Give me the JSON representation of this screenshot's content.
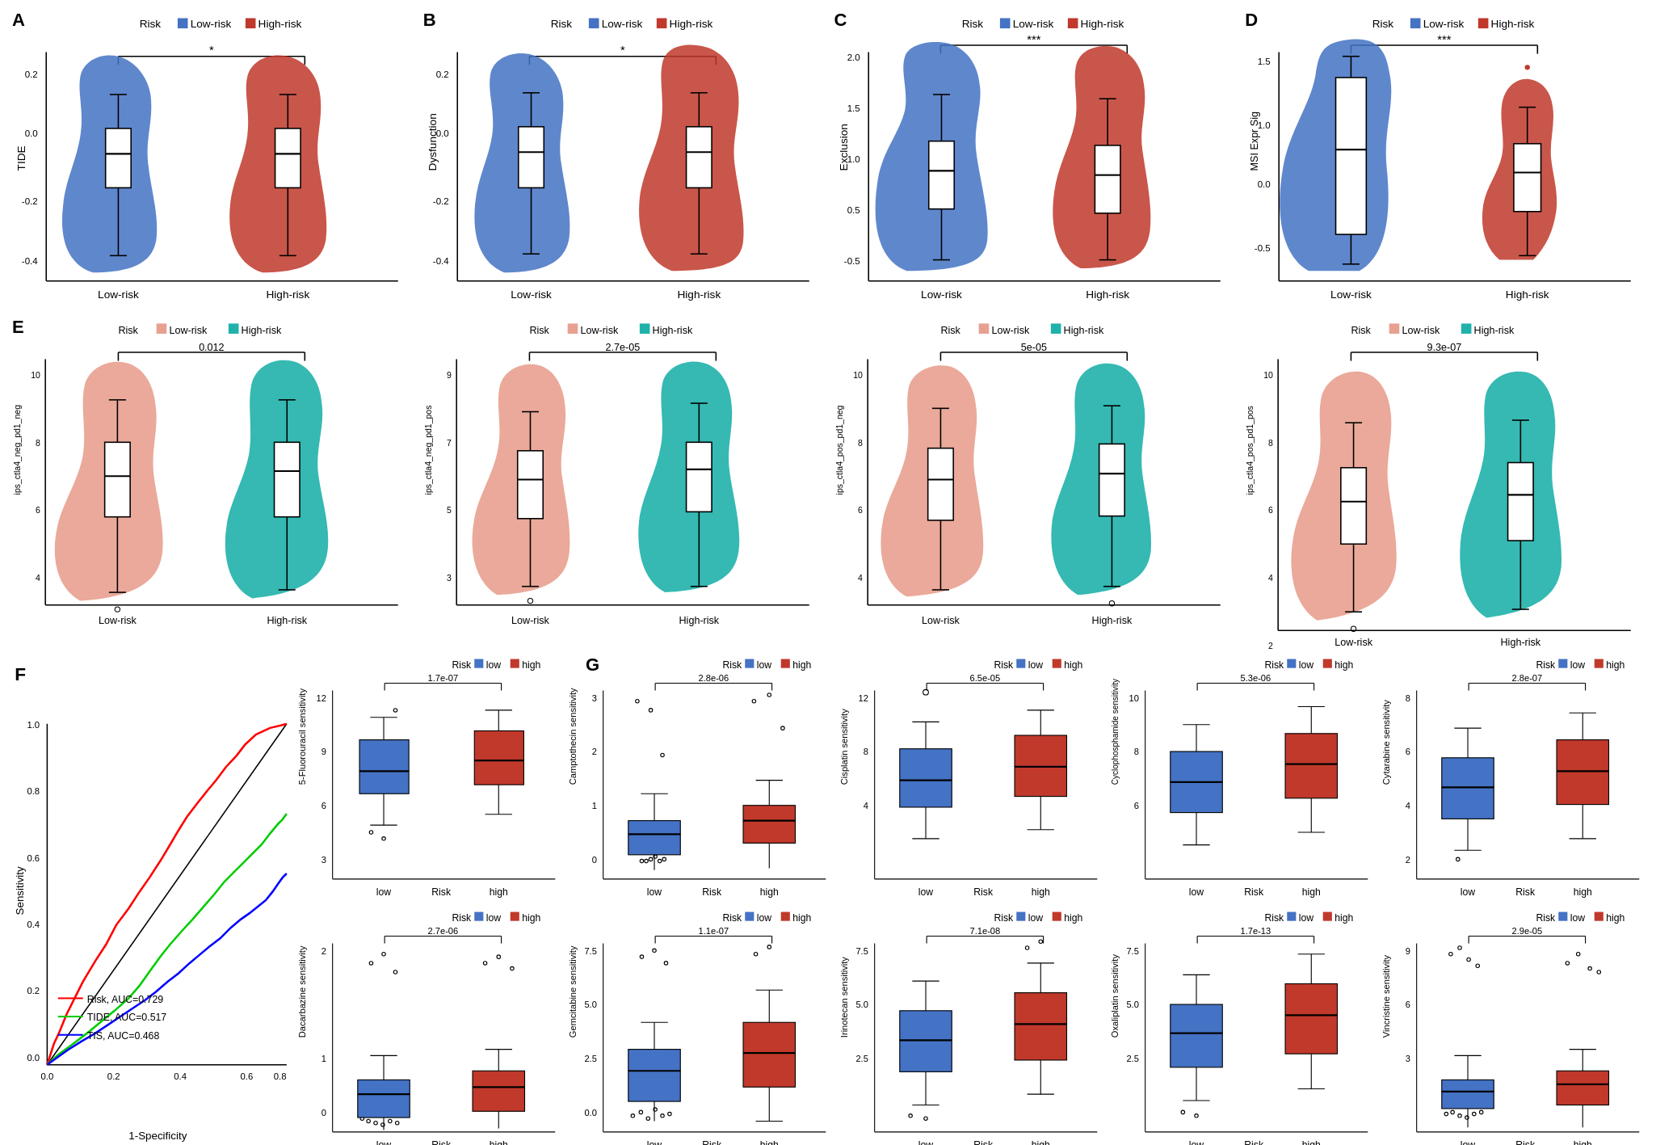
{
  "figure": {
    "panels": {
      "A": {
        "label": "A",
        "legend": {
          "title": "Risk",
          "low": "Low-risk",
          "high": "High-risk",
          "low_color": "#4472C4",
          "high_color": "#C0392B"
        },
        "ylabel": "TIDE",
        "xlabel_low": "Low-risk",
        "xlabel_high": "High-risk",
        "pvalue": "*"
      },
      "B": {
        "label": "B",
        "legend": {
          "title": "Risk",
          "low": "Low-risk",
          "high": "High-risk",
          "low_color": "#4472C4",
          "high_color": "#C0392B"
        },
        "ylabel": "Dysfunction",
        "xlabel_low": "Low-risk",
        "xlabel_high": "High-risk",
        "pvalue": "*"
      },
      "C": {
        "label": "C",
        "legend": {
          "title": "Risk",
          "low": "Low-risk",
          "high": "High-risk",
          "low_color": "#4472C4",
          "high_color": "#C0392B"
        },
        "ylabel": "Exclusion",
        "xlabel_low": "Low-risk",
        "xlabel_high": "High-risk",
        "pvalue": "***"
      },
      "D": {
        "label": "D",
        "legend": {
          "title": "Risk",
          "low": "Low-risk",
          "high": "High-risk",
          "low_color": "#4472C4",
          "high_color": "#C0392B"
        },
        "ylabel": "MSI Expr Sig",
        "xlabel_low": "Low-risk",
        "xlabel_high": "High-risk",
        "pvalue": "***"
      },
      "E": {
        "label": "E",
        "subplots": [
          {
            "ylabel": "ips_ctla4_neg_pd1_neg",
            "pvalue": "0.012",
            "low_color": "#E8A090",
            "high_color": "#20B2AA"
          },
          {
            "ylabel": "ips_ctla4_neg_pd1_pos",
            "pvalue": "2.7e-05",
            "low_color": "#E8A090",
            "high_color": "#20B2AA"
          },
          {
            "ylabel": "ips_ctla4_pos_pd1_neg",
            "pvalue": "5e-05",
            "low_color": "#E8A090",
            "high_color": "#20B2AA"
          },
          {
            "ylabel": "ips_ctla4_pos_pd1_pos",
            "pvalue": "9.3e-07",
            "low_color": "#E8A090",
            "high_color": "#20B2AA"
          }
        ]
      },
      "F": {
        "label": "F",
        "xlabel": "1-Specificity",
        "ylabel": "Sensitivity",
        "curves": [
          {
            "name": "Risk, AUC=0.729",
            "color": "#FF0000"
          },
          {
            "name": "TIDE, AUC=0.517",
            "color": "#00CC00"
          },
          {
            "name": "TIS, AUC=0.468",
            "color": "#0000FF"
          }
        ],
        "diagonal": "#000000"
      },
      "G": {
        "label": "G",
        "row1": [
          {
            "drug": "5-Fluorouracil sensitivity",
            "pvalue": "1.7e-07",
            "low_color": "#4472C4",
            "high_color": "#C0392B"
          },
          {
            "drug": "Camptothecin sensitivity",
            "pvalue": "2.8e-06",
            "low_color": "#4472C4",
            "high_color": "#C0392B"
          },
          {
            "drug": "Cisplatin sensitivity",
            "pvalue": "6.5e-05",
            "low_color": "#4472C4",
            "high_color": "#C0392B"
          },
          {
            "drug": "Cyclophosphamide sensitivity",
            "pvalue": "5.3e-06",
            "low_color": "#4472C4",
            "high_color": "#C0392B"
          },
          {
            "drug": "Cytarabine sensitivity",
            "pvalue": "2.8e-07",
            "low_color": "#4472C4",
            "high_color": "#C0392B"
          }
        ],
        "row2": [
          {
            "drug": "Dacarbazine sensitivity",
            "pvalue": "2.7e-06",
            "low_color": "#4472C4",
            "high_color": "#C0392B"
          },
          {
            "drug": "Gemcitabine sensitivity",
            "pvalue": "1.1e-07",
            "low_color": "#4472C4",
            "high_color": "#C0392B"
          },
          {
            "drug": "Irinotecan sensitivity",
            "pvalue": "7.1e-08",
            "low_color": "#4472C4",
            "high_color": "#C0392B"
          },
          {
            "drug": "Oxaliplatin sensitivity",
            "pvalue": "1.7e-13",
            "low_color": "#4472C4",
            "high_color": "#C0392B"
          },
          {
            "drug": "Vincristine sensitivity",
            "pvalue": "2.9e-05",
            "low_color": "#4472C4",
            "high_color": "#C0392B"
          }
        ]
      }
    }
  }
}
